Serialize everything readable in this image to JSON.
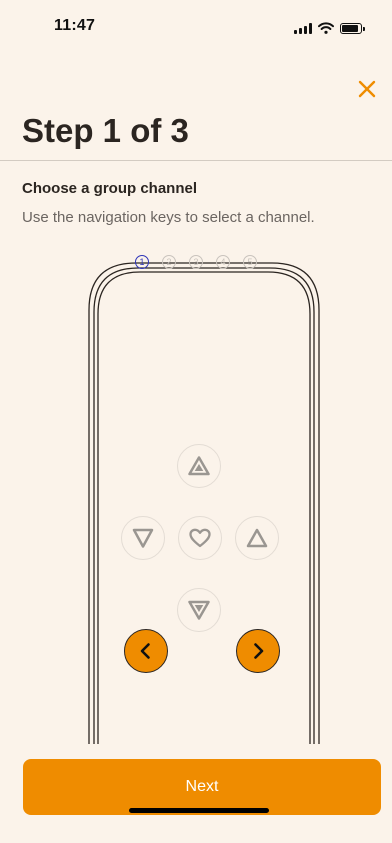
{
  "status_bar": {
    "time": "11:47",
    "battery_level": 0.8,
    "icons": [
      "signal-icon",
      "wifi-icon",
      "battery-icon"
    ]
  },
  "header": {
    "close_icon": "close-icon",
    "title": "Step 1 of 3"
  },
  "content": {
    "heading": "Choose a group channel",
    "description": "Use the navigation keys to select a channel."
  },
  "remote": {
    "channels": [
      {
        "label": "1",
        "active": true
      },
      {
        "label": "2",
        "active": false
      },
      {
        "label": "3",
        "active": false
      },
      {
        "label": "4",
        "active": false
      },
      {
        "label": "5",
        "active": false
      }
    ],
    "keys": [
      "up-key",
      "down-key",
      "heart-key",
      "up-small-key",
      "down-key-lower",
      "previous-key",
      "next-key"
    ]
  },
  "footer": {
    "next_label": "Next"
  },
  "colors": {
    "background": "#fbf3ea",
    "accent": "#ef8c00",
    "active_channel": "#2f35b8",
    "text": "#2b2521",
    "muted_text": "#6b6561"
  }
}
